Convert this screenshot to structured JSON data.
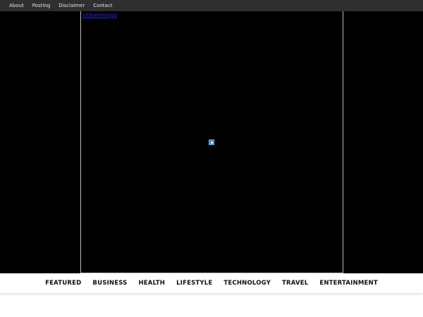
{
  "topbar": {
    "links": [
      "About",
      "Posting",
      "Disclaimer",
      "Contact"
    ]
  },
  "hero": {
    "logo_alt": "siteamalogo",
    "image_icon": "broken-image-icon"
  },
  "main_nav": {
    "items": [
      "FEATURED",
      "BUSINESS",
      "HEALTH",
      "LIFESTYLE",
      "TECHNOLOGY",
      "TRAVEL",
      "ENTERTAINMENT"
    ]
  },
  "colors": {
    "topbar_bg": "#2f2f2f",
    "hero_bg": "#000000",
    "logo_link": "#2a2ad8"
  }
}
